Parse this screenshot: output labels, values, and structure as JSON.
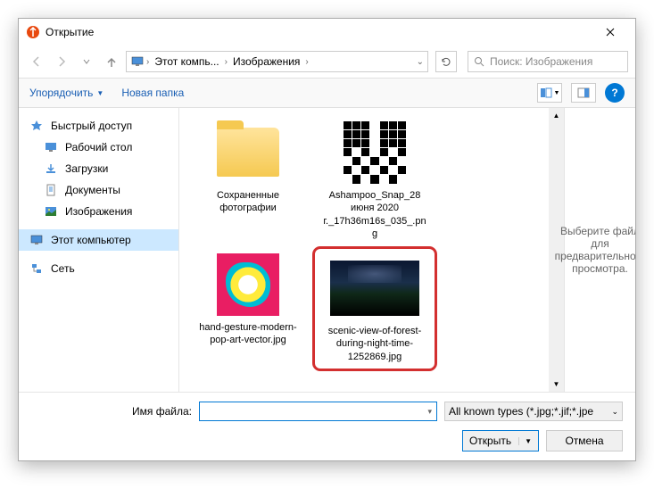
{
  "title": "Открытие",
  "breadcrumb": {
    "root": "Этот компь...",
    "folder": "Изображения"
  },
  "search": {
    "placeholder": "Поиск: Изображения"
  },
  "toolbar": {
    "organize": "Упорядочить",
    "newfolder": "Новая папка"
  },
  "sidebar": {
    "quick": "Быстрый доступ",
    "desktop": "Рабочий стол",
    "downloads": "Загрузки",
    "documents": "Документы",
    "pictures": "Изображения",
    "thispc": "Этот компьютер",
    "network": "Сеть"
  },
  "files": [
    {
      "name": "Сохраненные фотографии",
      "type": "folder"
    },
    {
      "name": "Ashampoo_Snap_28 июня 2020 г._17h36m16s_035_.png",
      "type": "qr"
    },
    {
      "name": "hand-gesture-modern-pop-art-vector.jpg",
      "type": "popart"
    },
    {
      "name": "scenic-view-of-forest-during-night-time-1252869.jpg",
      "type": "night",
      "highlighted": true
    }
  ],
  "preview": "Выберите файл для предварительного просмотра.",
  "filename_label": "Имя файла:",
  "filetype": "All known types (*.jpg;*.jif;*.jpe",
  "buttons": {
    "open": "Открыть",
    "cancel": "Отмена"
  }
}
